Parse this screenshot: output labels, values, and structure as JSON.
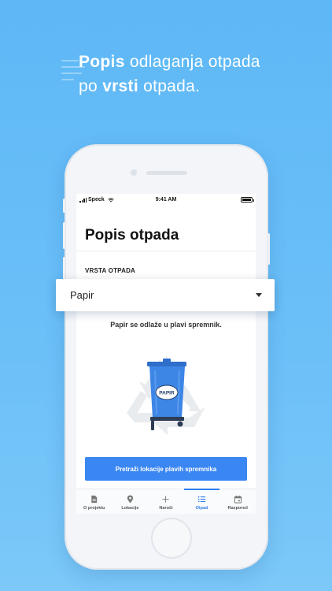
{
  "headline": {
    "line1_bold": "Popis",
    "line1_rest": " odlaganja otpada",
    "line2_pre": "po ",
    "line2_bold": "vrsti",
    "line2_post": " otpada."
  },
  "status_bar": {
    "carrier": "Speck",
    "time": "9:41 AM",
    "battery_level": 1.0
  },
  "app": {
    "title": "Popis otpada",
    "section_label": "VRSTA OTPADA",
    "select": {
      "value": "Papir"
    },
    "info": "Papir se odlaže u plavi spremnik.",
    "bin_label": "PAPIR",
    "cta": "Pretraži lokacije plavih spremnika"
  },
  "tabbar": {
    "items": [
      {
        "label": "O projektu",
        "icon": "document-icon",
        "active": false
      },
      {
        "label": "Lokacije",
        "icon": "location-pin-icon",
        "active": false
      },
      {
        "label": "Naruči",
        "icon": "plus-icon",
        "active": false
      },
      {
        "label": "Otpad",
        "icon": "list-icon",
        "active": true
      },
      {
        "label": "Raspored",
        "icon": "calendar-icon",
        "active": false
      }
    ]
  },
  "colors": {
    "background": "#6cc0f8",
    "accent": "#3a86f2",
    "bin_blue": "#3d86e6",
    "tab_active": "#2f7fe8"
  }
}
